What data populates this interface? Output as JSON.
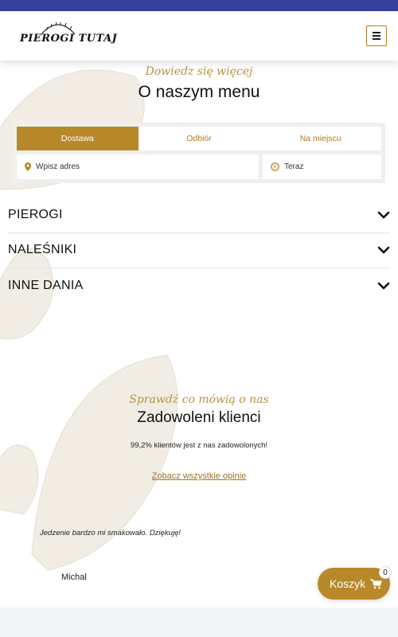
{
  "brand": {
    "logo_text": "PIEROGI TUTAJ"
  },
  "header": {
    "menu_icon": "hamburger-icon"
  },
  "menu_section": {
    "script_heading": "Dowiedz się więcej",
    "title": "O naszym menu"
  },
  "order": {
    "tabs": [
      "Dostawa",
      "Odbiór",
      "Na miejscu"
    ],
    "active_tab": "Dostawa",
    "address_placeholder": "Wpisz adres",
    "time_value": "Teraz"
  },
  "categories": [
    "PIEROGI",
    "NALEŚNIKI",
    "INNE DANIA"
  ],
  "reviews": {
    "script_heading": "Sprawdź co mówią o nas",
    "title": "Zadowoleni klienci",
    "subtitle": "99,2% klientów jest z nas zadowolonych!",
    "link": "Zobacz wszystkie opinie",
    "review_text": "Jedzenie bardzo mi smakowało. Dziękuję!",
    "review_author": "Michal"
  },
  "cart": {
    "label": "Koszyk",
    "count": "0"
  },
  "colors": {
    "accent": "#b8892b",
    "topbar": "#35409a",
    "script": "#b8923f"
  }
}
